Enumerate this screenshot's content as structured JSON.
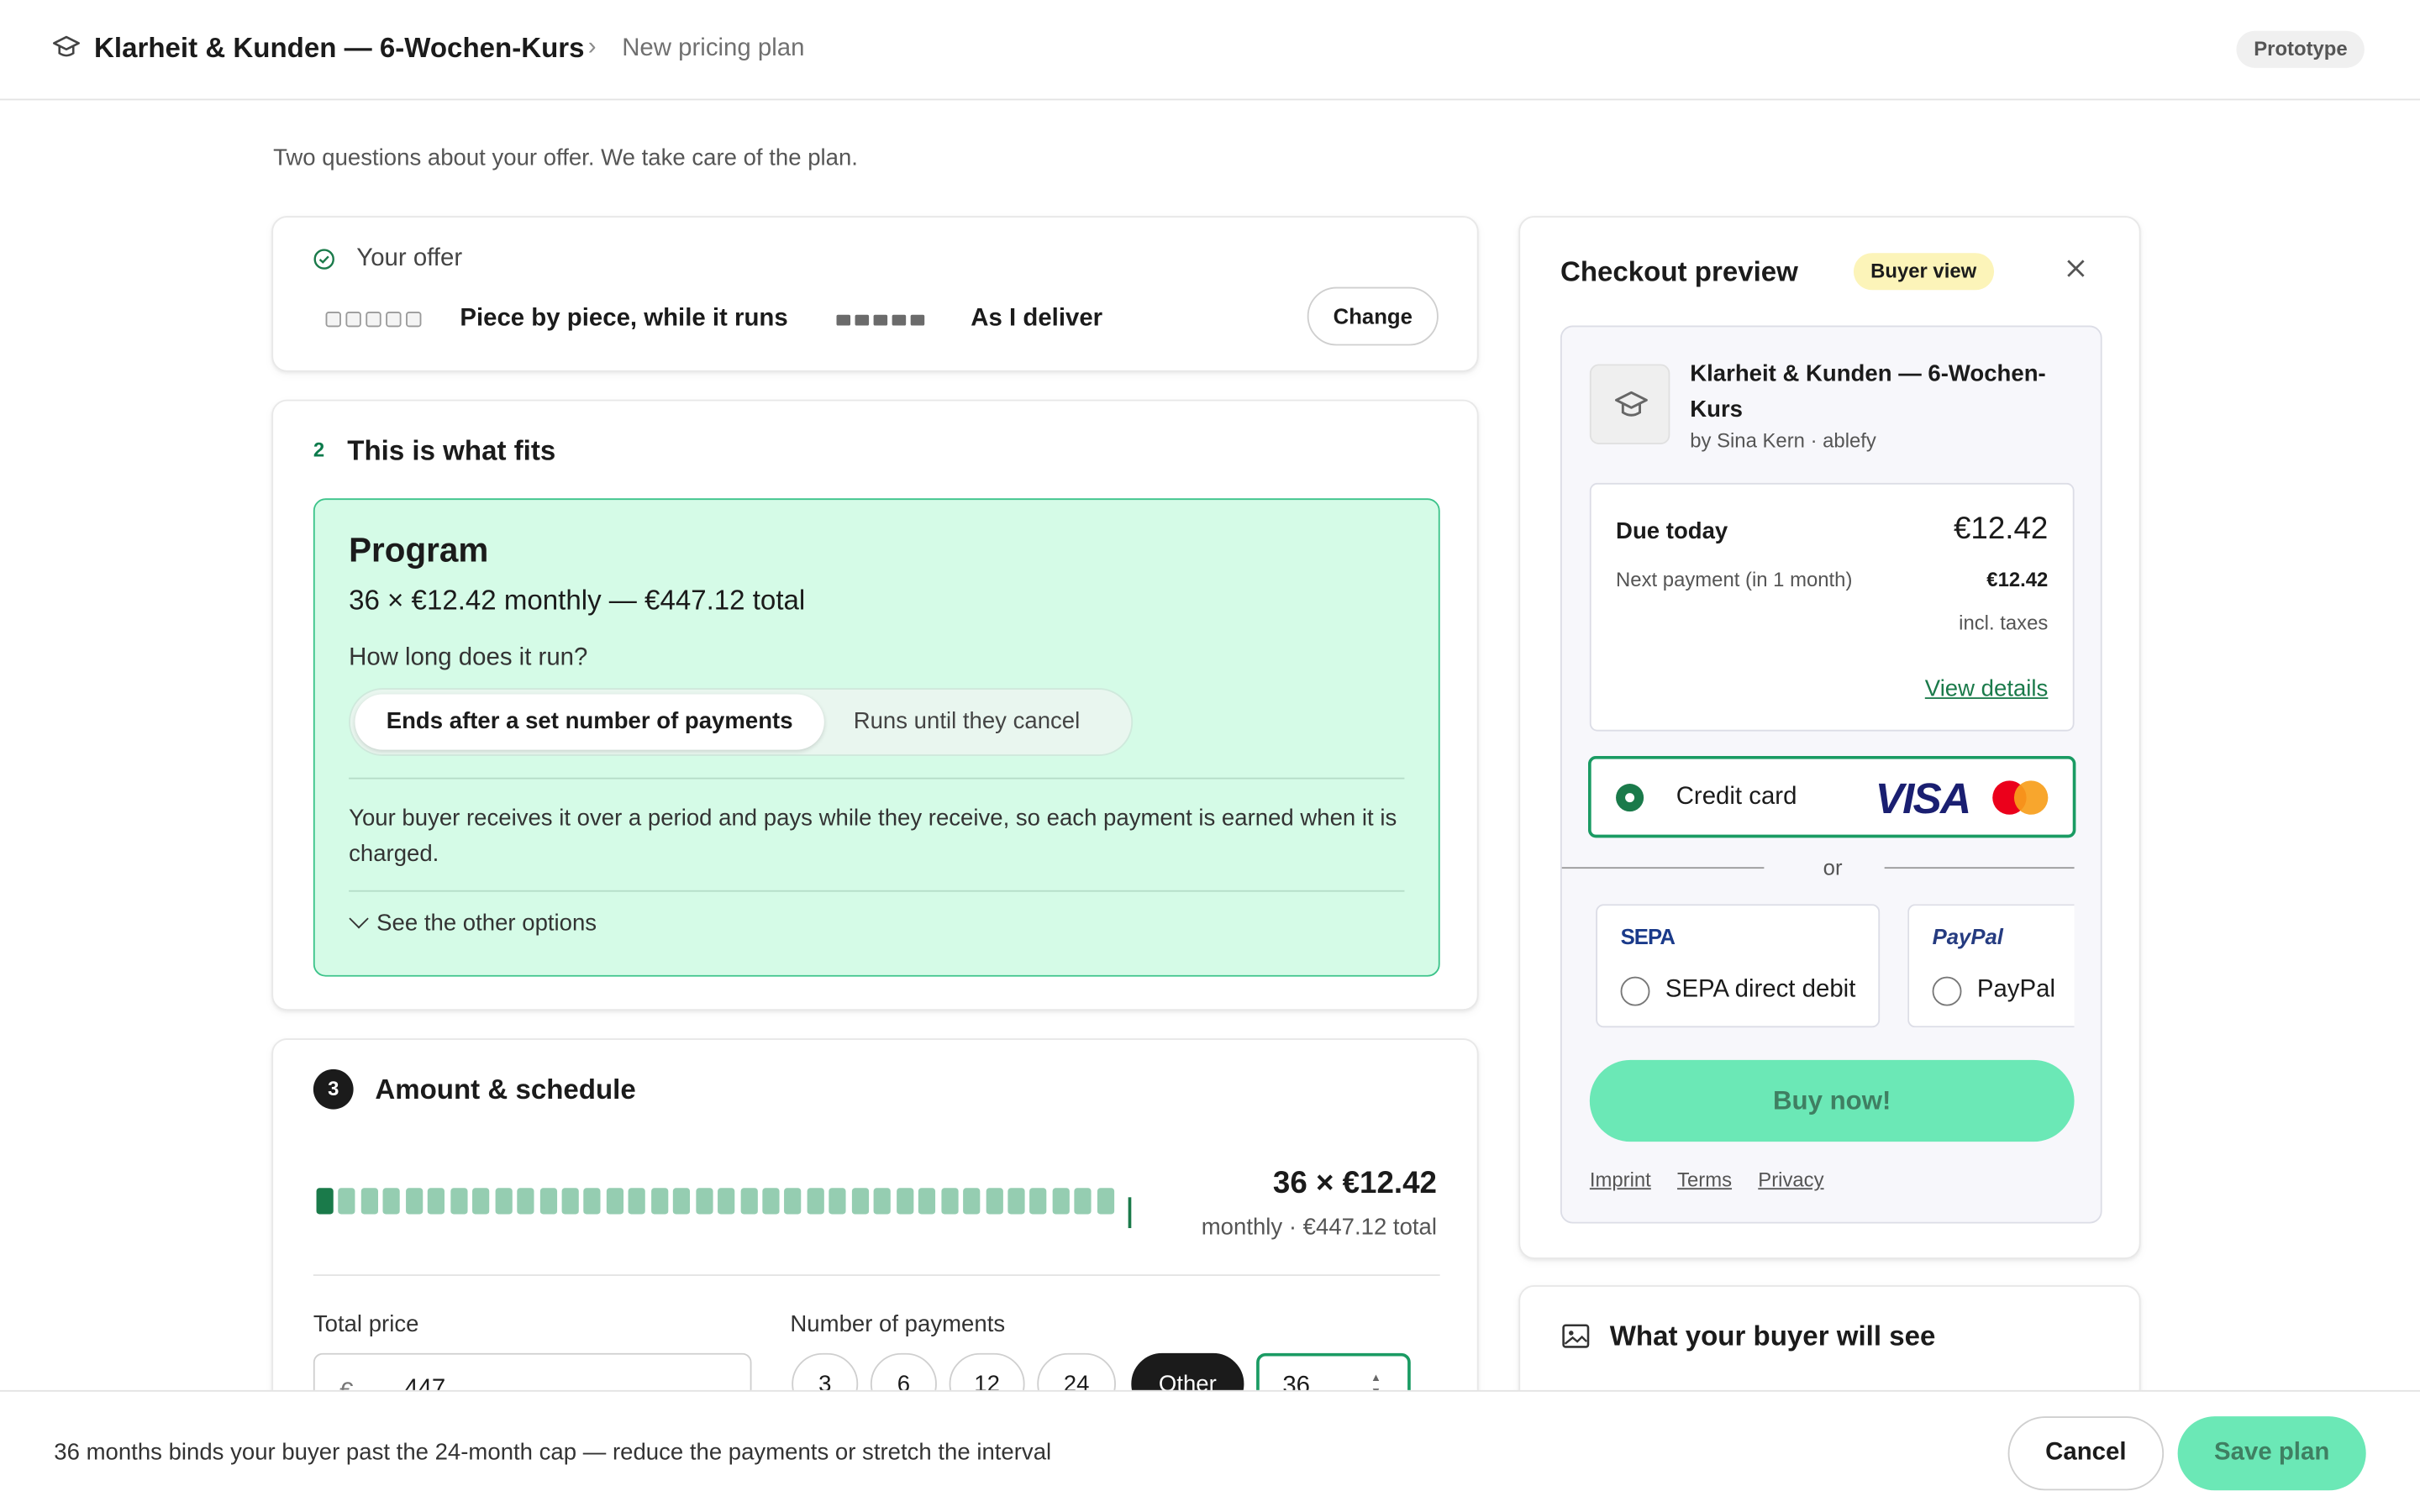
{
  "header": {
    "course_title": "Klarheit & Kunden — 6-Wochen-Kurs",
    "breadcrumb_sep": "›",
    "breadcrumb_current": "New pricing plan",
    "badge": "Prototype"
  },
  "intro": "Two questions about your offer. We take care of the plan.",
  "offer": {
    "heading": "Your offer",
    "option_delivery": "Piece by piece, while it runs",
    "option_payment": "As I deliver",
    "change_label": "Change"
  },
  "fits": {
    "step": "2",
    "heading": "This is what fits",
    "plan_title": "Program",
    "plan_summary": "36 × €12.42 monthly — €447.12 total",
    "question": "How long does it run?",
    "segment_selected": "Ends after a set number of payments",
    "segment_other": "Runs until they cancel",
    "description": "Your buyer receives it over a period and pays while they receive, so each payment is earned when it is charged.",
    "more_label": "See the other options"
  },
  "amount": {
    "step": "3",
    "heading": "Amount & schedule",
    "payment_count": 36,
    "summary_big": "36 × €12.42",
    "summary_small": "monthly · €447.12 total",
    "total_label": "Total price",
    "currency": "€ ⌄",
    "total_value": "447",
    "payments_label": "Number of payments",
    "chips": [
      "3",
      "6",
      "12",
      "24",
      "Other"
    ],
    "custom_value": "36",
    "spinner": "▲\n▼"
  },
  "checkout": {
    "heading": "Checkout preview",
    "badge": "Buyer view",
    "product_title": "Klarheit & Kunden — 6-Wochen-Kurs",
    "product_by": "by Sina Kern · ablefy",
    "due_label": "Due today",
    "due_value": "€12.42",
    "next_label": "Next payment (in 1 month)",
    "next_value": "€12.42",
    "taxes": "incl. taxes",
    "details_link": "View details",
    "card_label": "Credit card",
    "visa": "VISA",
    "or": "or",
    "sepa_logo": "SEPA",
    "sepa_label": "SEPA direct debit",
    "paypal_logo": "PayPal",
    "paypal_label": "PayPal",
    "buy_label": "Buy now!",
    "links": [
      "Imprint",
      "Terms",
      "Privacy"
    ]
  },
  "buyer_sees": {
    "heading": "What your buyer will see"
  },
  "footer": {
    "message": "36 months binds your buyer past the 24-month cap — reduce the payments or stretch the interval",
    "cancel_label": "Cancel",
    "save_label": "Save plan"
  },
  "colors": {
    "accent_green": "#1a7a4a",
    "panel_green": "#d5fbe7",
    "button_mint": "#6be8b6"
  }
}
